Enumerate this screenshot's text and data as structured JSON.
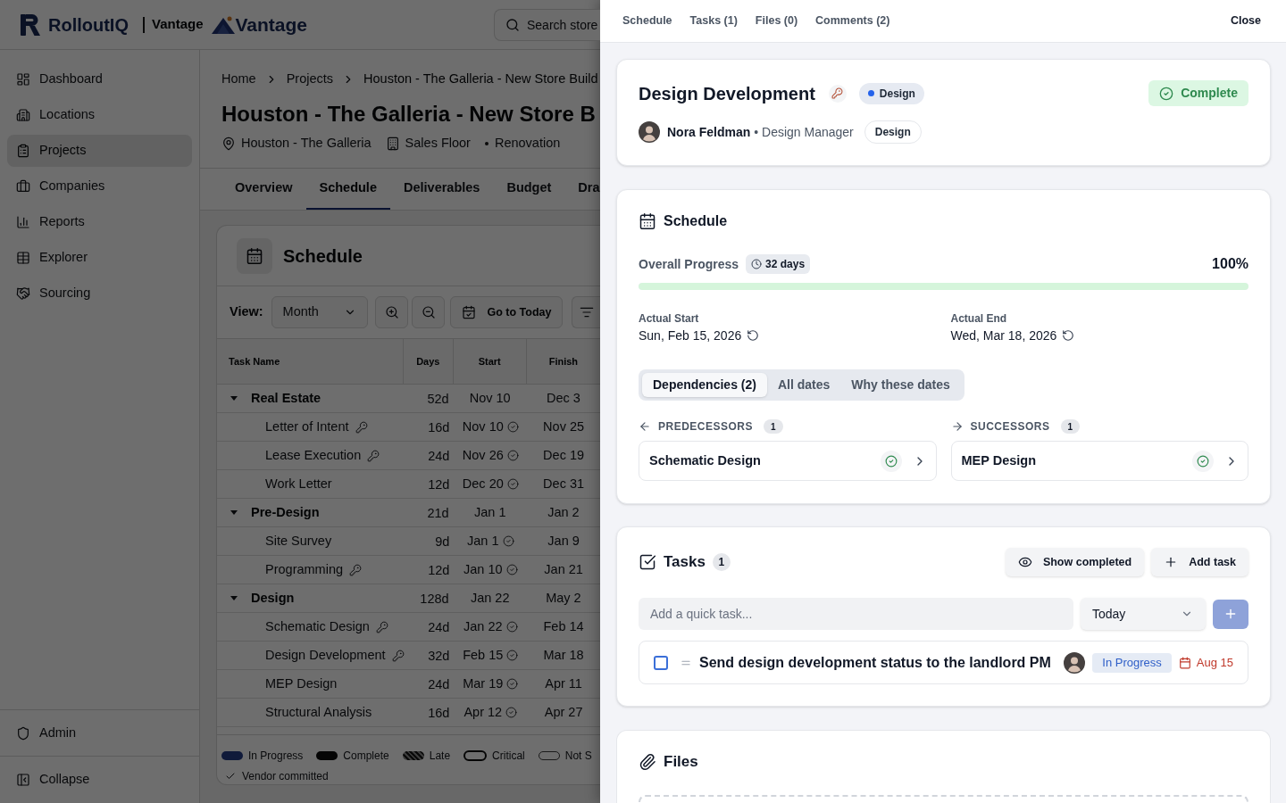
{
  "app_header": {
    "logo_text": "RolloutIQ",
    "workspace": "Vantage",
    "brand_text": "Vantage",
    "search": {
      "placeholder": "Search store"
    }
  },
  "sidebar": {
    "items": [
      {
        "label": "Dashboard",
        "selected": false
      },
      {
        "label": "Locations",
        "selected": false
      },
      {
        "label": "Projects",
        "selected": true
      },
      {
        "label": "Companies",
        "selected": false
      },
      {
        "label": "Reports",
        "selected": false
      },
      {
        "label": "Explorer",
        "selected": false
      },
      {
        "label": "Sourcing",
        "selected": false
      }
    ],
    "footer": [
      {
        "label": "Admin"
      },
      {
        "label": "Collapse"
      }
    ]
  },
  "breadcrumb": [
    "Home",
    "Projects",
    "Houston - The Galleria - New Store Build"
  ],
  "project": {
    "title": "Houston - The Galleria - New Store B",
    "location": "Houston - The Galleria",
    "area": "Sales Floor",
    "type": "Renovation"
  },
  "project_tabs": [
    {
      "label": "Overview",
      "selected": false
    },
    {
      "label": "Schedule",
      "selected": true
    },
    {
      "label": "Deliverables",
      "selected": false
    },
    {
      "label": "Budget",
      "selected": false
    },
    {
      "label": "Dra",
      "selected": false
    }
  ],
  "schedule_view": {
    "title": "Schedule",
    "view_label": "View:",
    "view_value": "Month",
    "today_button": "Go to Today",
    "table": {
      "columns": [
        "Task Name",
        "Days",
        "Start",
        "Finish"
      ],
      "rows": [
        {
          "name": "Real Estate",
          "days": "52d",
          "start": "Nov 10",
          "finish": "Dec 3",
          "expanded": true,
          "children": [
            {
              "name": "Letter of Intent",
              "key": true,
              "days": "16d",
              "start": "Nov 10",
              "committed": true,
              "finish": "Nov 25"
            },
            {
              "name": "Lease Execution",
              "key": true,
              "days": "24d",
              "start": "Nov 26",
              "committed": true,
              "finish": "Dec 19"
            },
            {
              "name": "Work Letter",
              "key": false,
              "days": "12d",
              "start": "Dec 20",
              "committed": true,
              "finish": "Dec 31"
            }
          ]
        },
        {
          "name": "Pre-Design",
          "days": "21d",
          "start": "Jan 1",
          "finish": "Jan 2",
          "expanded": true,
          "children": [
            {
              "name": "Site Survey",
              "key": false,
              "days": "9d",
              "start": "Jan 1",
              "committed": true,
              "finish": "Jan 9"
            },
            {
              "name": "Programming",
              "key": true,
              "days": "12d",
              "start": "Jan 10",
              "committed": true,
              "finish": "Jan 21"
            }
          ]
        },
        {
          "name": "Design",
          "days": "128d",
          "start": "Jan 22",
          "finish": "May 2",
          "expanded": true,
          "children": [
            {
              "name": "Schematic Design",
              "key": true,
              "days": "24d",
              "start": "Jan 22",
              "committed": true,
              "finish": "Feb 14"
            },
            {
              "name": "Design Development",
              "key": true,
              "days": "32d",
              "start": "Feb 15",
              "committed": true,
              "finish": "Mar 18"
            },
            {
              "name": "MEP Design",
              "key": false,
              "days": "24d",
              "start": "Mar 19",
              "committed": true,
              "finish": "Apr 11"
            },
            {
              "name": "Structural Analysis",
              "key": false,
              "days": "16d",
              "start": "Apr 12",
              "committed": true,
              "finish": "Apr 27"
            }
          ]
        }
      ]
    },
    "legend": [
      {
        "label": "In Progress",
        "kind": "progress"
      },
      {
        "label": "Complete",
        "kind": "solid"
      },
      {
        "label": "Late",
        "kind": "hatched"
      },
      {
        "label": "Critical",
        "kind": "ring"
      },
      {
        "label": "Not S",
        "kind": "outline"
      }
    ],
    "legend_note": "Vendor committed"
  },
  "detail_panel": {
    "nav": [
      "Schedule",
      "Tasks (1)",
      "Files (0)",
      "Comments (2)"
    ],
    "close": "Close",
    "task": {
      "title": "Design Development",
      "key_milestone": true,
      "phase": {
        "label": "Design",
        "color": "#2563eb"
      },
      "status": {
        "label": "Complete",
        "kind": "complete"
      },
      "owner_line": "**Nora Feldman** • Design Manager",
      "role_tag": "Design"
    },
    "schedule": {
      "title": "Schedule",
      "progress": {
        "label": "Overall Progress",
        "duration": "32 days",
        "reading": "100%",
        "level": 1
      },
      "dates": [
        {
          "label": "Actual Start",
          "value": "Sun, Feb 15, 2026"
        },
        {
          "label": "Actual End",
          "value": "Wed, Mar 18, 2026"
        }
      ],
      "tabs": [
        {
          "label": "Dependencies (2)",
          "selected": true
        },
        {
          "label": "All dates",
          "selected": false
        },
        {
          "label": "Why these dates",
          "selected": false
        }
      ],
      "dependencies": [
        {
          "kind": "incoming",
          "label": "PREDECESSORS",
          "count": "1",
          "items": [
            {
              "name": "Schematic Design",
              "complete": true
            }
          ]
        },
        {
          "kind": "outgoing",
          "label": "SUCCESSORS",
          "count": "1",
          "items": [
            {
              "name": "MEP Design",
              "complete": true
            }
          ]
        }
      ]
    },
    "tasks": {
      "title": "Tasks",
      "count": "1",
      "show_completed": "Show completed",
      "add_task": "Add task",
      "quick_add": {
        "placeholder": "Add a quick task..."
      },
      "due_select": "Today",
      "items": [
        {
          "title": "Send design development status to the landlord PM",
          "checked": false,
          "status": {
            "label": "In Progress",
            "kind": "in_progress"
          },
          "due": "Aug 15",
          "overdue": true
        }
      ]
    },
    "files": {
      "title": "Files"
    }
  }
}
